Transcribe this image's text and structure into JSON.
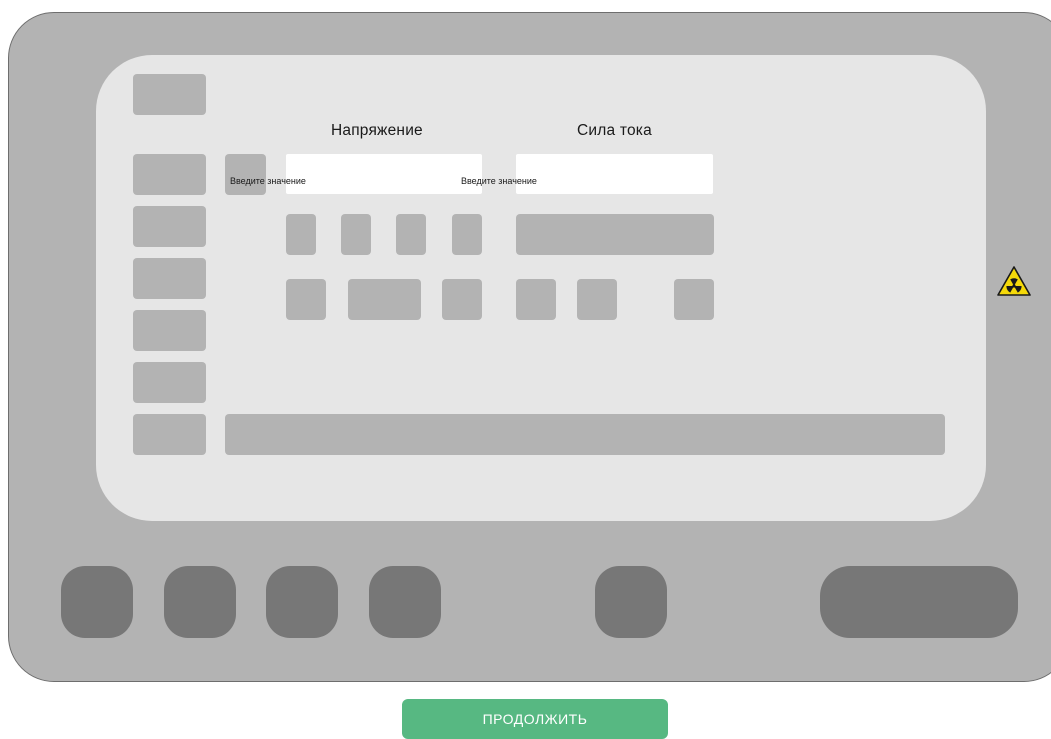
{
  "voltage": {
    "title": "Напряжение",
    "input_placeholder": "Введите значение",
    "input_value": ""
  },
  "current": {
    "title": "Сила тока",
    "input_placeholder": "Введите значение",
    "input_value": ""
  },
  "continue_button": {
    "label": "ПРОДОЛЖИТЬ"
  },
  "colors": {
    "device_body": "#b3b3b3",
    "screen": "#e6e6e6",
    "placeholder_block": "#b3b3b3",
    "hardware_button": "#777777",
    "continue_button": "#57b882",
    "hazard_fill": "#f5d90a"
  },
  "icons": {
    "hazard": "radiation-warning-icon"
  }
}
